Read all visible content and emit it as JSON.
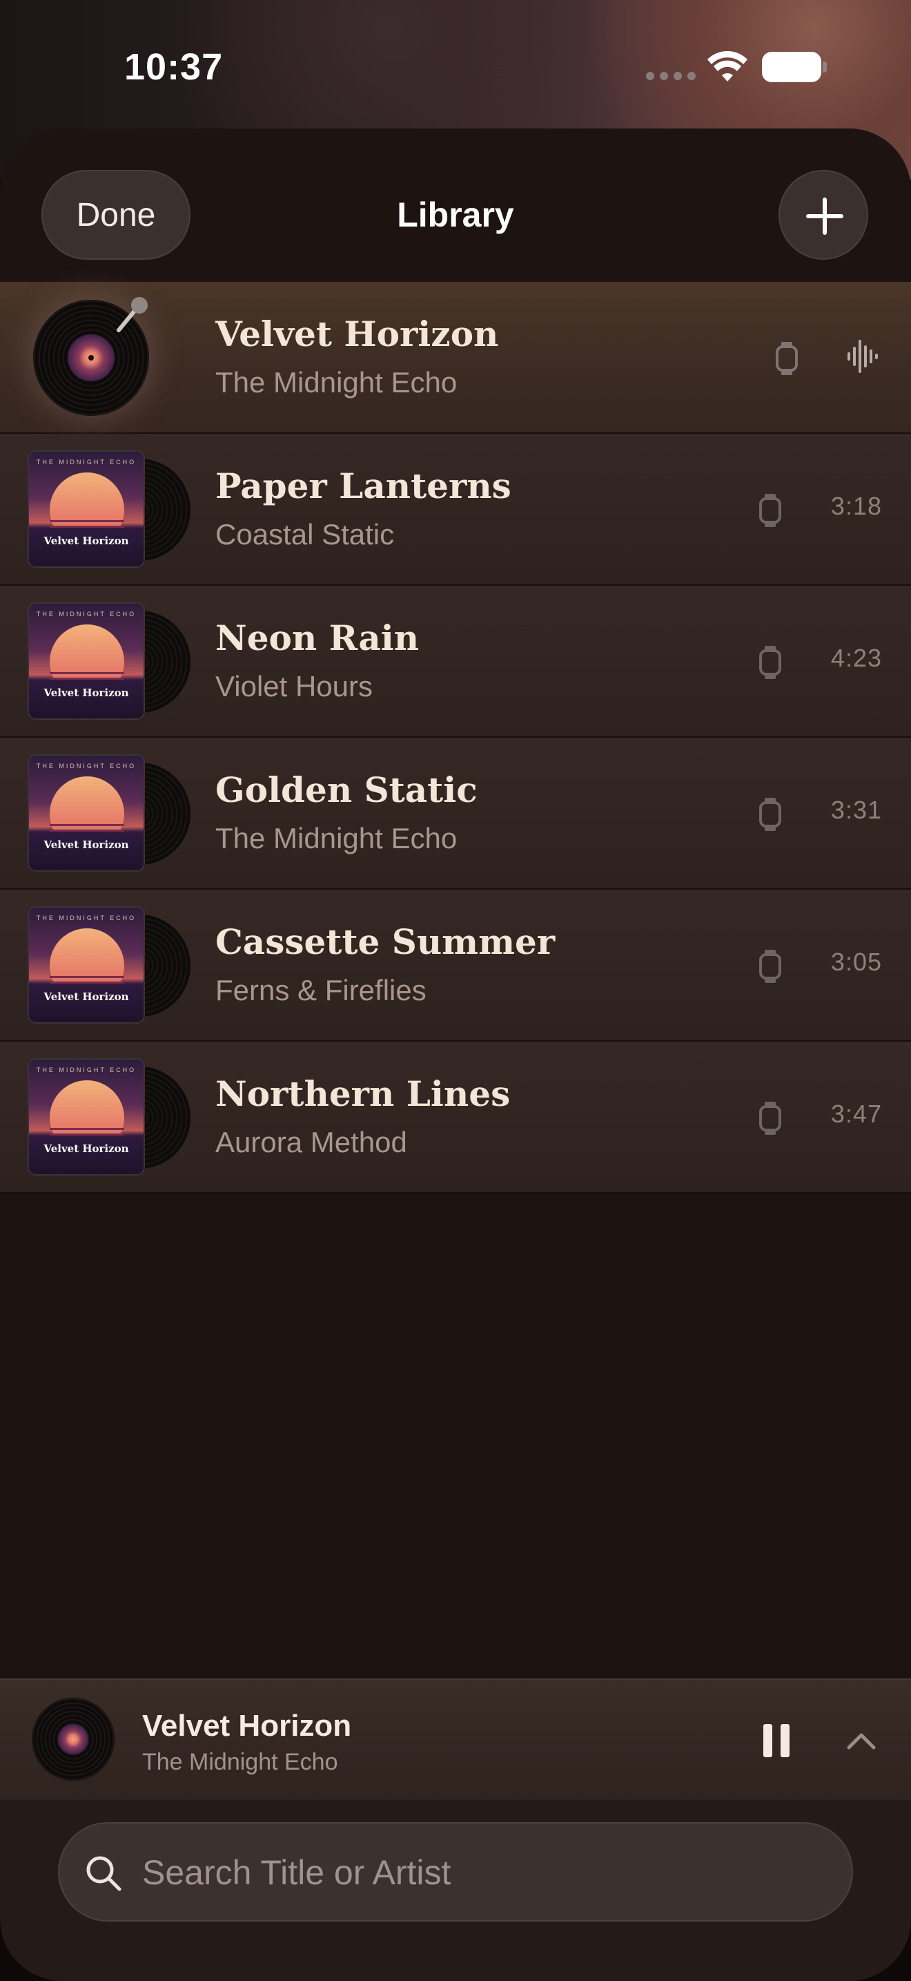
{
  "status_bar": {
    "time": "10:37"
  },
  "header": {
    "done_label": "Done",
    "title": "Library",
    "add_icon": "plus-icon"
  },
  "now_playing_row_index": 0,
  "songs": [
    {
      "title": "Velvet Horizon",
      "artist": "The Midnight Echo",
      "duration": "",
      "playing": true
    },
    {
      "title": "Paper Lanterns",
      "artist": "Coastal Static",
      "duration": "3:18",
      "album_top": "THE MIDNIGHT ECHO",
      "album_name": "Velvet Horizon"
    },
    {
      "title": "Neon Rain",
      "artist": "Violet Hours",
      "duration": "4:23",
      "album_top": "THE MIDNIGHT ECHO",
      "album_name": "Velvet Horizon"
    },
    {
      "title": "Golden Static",
      "artist": "The Midnight Echo",
      "duration": "3:31",
      "album_top": "THE MIDNIGHT ECHO",
      "album_name": "Velvet Horizon"
    },
    {
      "title": "Cassette Summer",
      "artist": "Ferns & Fireflies",
      "duration": "3:05",
      "album_top": "THE MIDNIGHT ECHO",
      "album_name": "Velvet Horizon"
    },
    {
      "title": "Northern Lines",
      "artist": "Aurora Method",
      "duration": "3:47",
      "album_top": "THE MIDNIGHT ECHO",
      "album_name": "Velvet Horizon"
    }
  ],
  "mini_player": {
    "title": "Velvet Horizon",
    "artist": "The Midnight Echo"
  },
  "search": {
    "placeholder": "Search Title or Artist",
    "value": ""
  },
  "colors": {
    "background": "#1c1311",
    "row": "#2d221f",
    "active_row": "#3b2b22",
    "accent_text": "#f4e6d6"
  }
}
